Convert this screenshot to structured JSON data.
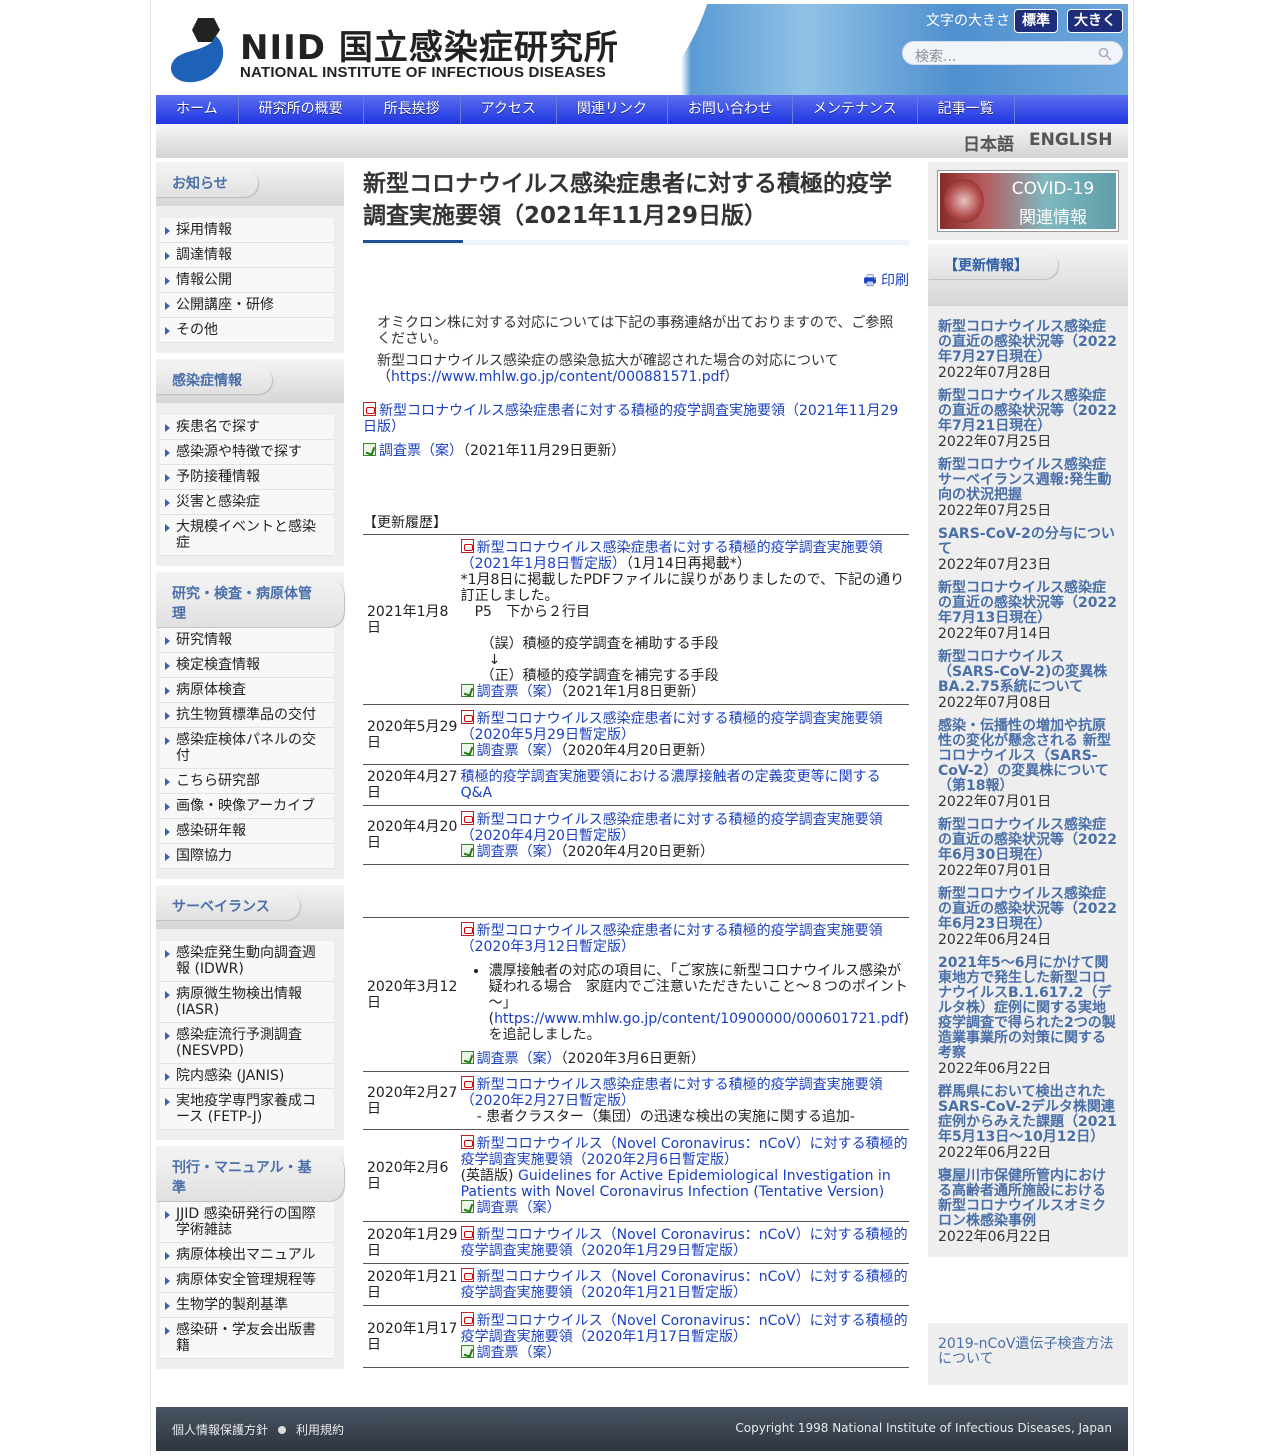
{
  "header": {
    "logo_jp": "NIID 国立感染症研究所",
    "logo_en": "NATIONAL INSTITUTE OF INFECTIOUS DISEASES",
    "fontsize_label": "文字の大きさ",
    "fontsize_normal": "標準",
    "fontsize_large": "大きく",
    "search_placeholder": "検索..."
  },
  "nav": [
    "ホーム",
    "研究所の概要",
    "所長挨拶",
    "アクセス",
    "関連リンク",
    "お問い合わせ",
    "メンテナンス",
    "記事一覧"
  ],
  "lang": {
    "jp": "日本語",
    "en": "ENGLISH"
  },
  "left": [
    {
      "title": "お知らせ",
      "items": [
        "採用情報",
        "調達情報",
        "情報公開",
        "公開講座・研修",
        "その他"
      ]
    },
    {
      "title": "感染症情報",
      "items": [
        "疾患名で探す",
        "感染源や特徴で探す",
        "予防接種情報",
        "災害と感染症",
        "大規模イベントと感染症"
      ]
    },
    {
      "title": "研究・検査・病原体管理",
      "items": [
        "研究情報",
        "検定検査情報",
        "病原体検査",
        "抗生物質標準品の交付",
        "感染症検体パネルの交付",
        "こちら研究部",
        "画像・映像アーカイブ",
        "感染研年報",
        "国際協力"
      ]
    },
    {
      "title": "サーベイランス",
      "items": [
        "感染症発生動向調査週報 (IDWR)",
        "病原微生物検出情報 (IASR)",
        "感染症流行予測調査 (NESVPD)",
        "院内感染 (JANIS)",
        "実地疫学専門家養成コース (FETP-J)"
      ]
    },
    {
      "title": "刊行・マニュアル・基準",
      "items": [
        "JJID 感染研発行の国際学術雑誌",
        "病原体検出マニュアル",
        "病原体安全管理規程等",
        "生物学的製剤基準",
        "感染研・学友会出版書籍"
      ]
    }
  ],
  "main": {
    "title": "新型コロナウイルス感染症患者に対する積極的疫学調査実施要領（2021年11月29日版）",
    "print": "印刷",
    "intro1": "オミクロン株に対する対応については下記の事務連絡が出ておりますので、ご参照ください。",
    "intro2a": "新型コロナウイルス感染症の感染急拡大が確認された場合の対応について（",
    "intro2_link": "https://www.mhlw.go.jp/content/000881571.pdf",
    "intro2b": "）",
    "doc_link": "新型コロナウイルス感染症患者に対する積極的疫学調査実施要領（2021年11月29日版）",
    "survey_link": "調査票（案）",
    "survey_note": "（2021年11月29日更新）",
    "history_label": "【更新履歴】"
  },
  "history": {
    "r1": {
      "date": "2021年1月8日",
      "link": "新型コロナウイルス感染症患者に対する積極的疫学調査実施要領（2021年1月8日暫定版）",
      "note": "（1月14日再掲載*）",
      "fix1": "*1月8日に掲載したPDFファイルに誤りがありましたので、下記の通り訂正しました。",
      "fix2": "P5　下から２行目",
      "fix3": "（誤）積極的疫学調査を補助する手段",
      "fix4": "↓",
      "fix5": "（正）積極的疫学調査を補完する手段",
      "survey": "調査票（案）",
      "survey_note": "（2021年1月8日更新）"
    },
    "r2": {
      "date": "2020年5月29日",
      "link": "新型コロナウイルス感染症患者に対する積極的疫学調査実施要領（2020年5月29日暫定版）",
      "survey": "調査票（案）",
      "survey_note": "（2020年4月20日更新）"
    },
    "r3": {
      "date": "2020年4月27日",
      "link": "積極的疫学調査実施要領における濃厚接触者の定義変更等に関するQ&A"
    },
    "r4": {
      "date": "2020年4月20日",
      "link": "新型コロナウイルス感染症患者に対する積極的疫学調査実施要領（2020年4月20日暫定版）",
      "survey": "調査票（案）",
      "survey_note": "（2020年4月20日更新）"
    },
    "r5": {
      "date": "2020年3月12日",
      "link": "新型コロナウイルス感染症患者に対する積極的疫学調査実施要領（2020年3月12日暫定版）",
      "bullet_a": "濃厚接触者の対応の項目に、「ご家族に新型コロナウイルス感染が疑われる場合　家庭内でご注意いただきたいこと～８つのポイント～」(",
      "bullet_link": "https://www.mhlw.go.jp/content/10900000/000601721.pdf",
      "bullet_b": ")を追記しました。",
      "survey": "調査票（案）",
      "survey_note": "（2020年3月6日更新）"
    },
    "r6": {
      "date": "2020年2月27日",
      "link": "新型コロナウイルス感染症患者に対する積極的疫学調査実施要領（2020年2月27日暫定版）",
      "note": "- 患者クラスター（集団）の迅速な検出の実施に関する追加-"
    },
    "r7": {
      "date": "2020年2月6日",
      "link": "新型コロナウイルス（Novel Coronavirus：nCoV）に対する積極的疫学調査実施要領（2020年2月6日暫定版）",
      "en_label": "(英語版)",
      "en_link": "Guidelines for Active Epidemiological Investigation in Patients with Novel Coronavirus Infection (Tentative Version)",
      "survey": "調査票（案）"
    },
    "r8": {
      "date": "2020年1月29日",
      "link": "新型コロナウイルス（Novel Coronavirus：nCoV）に対する積極的疫学調査実施要領（2020年1月29日暫定版）"
    },
    "r9": {
      "date": "2020年1月21日",
      "link": "新型コロナウイルス（Novel Coronavirus：nCoV）に対する積極的疫学調査実施要領（2020年1月21日暫定版）"
    },
    "r10": {
      "date": "2020年1月17日",
      "link": "新型コロナウイルス（Novel Coronavirus：nCoV）に対する積極的疫学調査実施要領（2020年1月17日暫定版）",
      "survey": "調査票（案）"
    }
  },
  "right": {
    "covid1": "COVID-19",
    "covid2": "関連情報",
    "updates_title": "【更新情報】",
    "updates": [
      {
        "t": "新型コロナウイルス感染症の直近の感染状況等（2022年7月27日現在）",
        "d": "2022年07月28日"
      },
      {
        "t": "新型コロナウイルス感染症の直近の感染状況等（2022年7月21日現在）",
        "d": "2022年07月25日"
      },
      {
        "t": "新型コロナウイルス感染症サーベイランス週報:発生動向の状況把握",
        "d": "2022年07月25日"
      },
      {
        "t": "SARS-CoV-2の分与について",
        "d": "2022年07月23日"
      },
      {
        "t": "新型コロナウイルス感染症の直近の感染状況等（2022年7月13日現在）",
        "d": "2022年07月14日"
      },
      {
        "t": "新型コロナウイルス（SARS-CoV-2)の変異株BA.2.75系統について",
        "d": "2022年07月08日"
      },
      {
        "t": "感染・伝播性の増加や抗原性の変化が懸念される 新型コロナウイルス（SARS-CoV-2）の変異株について （第18報）",
        "d": "2022年07月01日"
      },
      {
        "t": "新型コロナウイルス感染症の直近の感染状況等（2022年6月30日現在）",
        "d": "2022年07月01日"
      },
      {
        "t": "新型コロナウイルス感染症の直近の感染状況等（2022年6月23日現在）",
        "d": "2022年06月24日"
      },
      {
        "t": "2021年5～6月にかけて関東地方で発生した新型コロナウイルスB.1.617.2（デルタ株）症例に関する実地疫学調査で得られた2つの製造業事業所の対策に関する考察",
        "d": "2022年06月22日"
      },
      {
        "t": "群馬県において検出されたSARS-CoV-2デルタ株関連症例からみえた課題（2021年5月13日～10月12日）",
        "d": "2022年06月22日"
      },
      {
        "t": "寝屋川市保健所管内における高齢者通所施設における新型コロナウイルスオミクロン株感染事例",
        "d": "2022年06月22日"
      }
    ],
    "gene": "2019-nCoV遺伝子検査方法について"
  },
  "footer": {
    "privacy": "個人情報保護方針",
    "terms": "利用規約",
    "copyright": "Copyright 1998 National Institute of Infectious Diseases, Japan"
  }
}
